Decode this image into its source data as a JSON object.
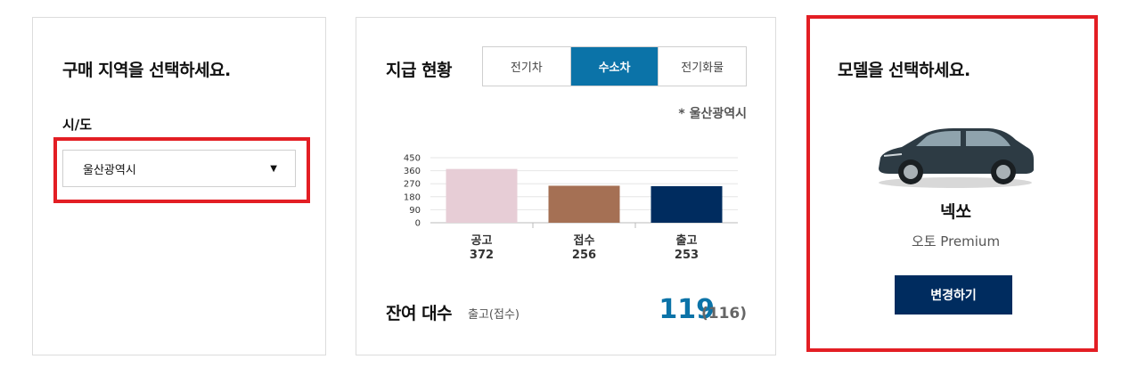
{
  "region_card": {
    "title": "구매 지역을 선택하세요.",
    "sido_label": "시/도",
    "select_value": "울산광역시",
    "select_arrow": "▼"
  },
  "status_card": {
    "title": "지급 현황",
    "tabs": [
      {
        "label": "전기차",
        "active": false
      },
      {
        "label": "수소차",
        "active": true
      },
      {
        "label": "전기화물",
        "active": false
      }
    ],
    "region_note": "* 울산광역시",
    "remaining_label": "잔여 대수",
    "remaining_sub": "출고(접수)",
    "remaining_value": "119",
    "remaining_paren": "(116)"
  },
  "chart_data": {
    "type": "bar",
    "categories": [
      "공고",
      "접수",
      "출고"
    ],
    "values": [
      372,
      256,
      253
    ],
    "value_labels": [
      "372",
      "256",
      "253"
    ],
    "colors": [
      "#e7cdd6",
      "#a57054",
      "#002c5f"
    ],
    "yticks": [
      "450",
      "360",
      "270",
      "180",
      "90",
      "0"
    ],
    "ylim": [
      0,
      450
    ],
    "grid": true
  },
  "model_card": {
    "title": "모델을 선택하세요.",
    "car_icon": "suv-car-image",
    "model_name": "넥쏘",
    "model_trim": "오토 Premium",
    "change_label": "변경하기"
  },
  "colors": {
    "accent_blue": "#0b73a8",
    "navy": "#002c5f",
    "highlight_red": "#e31e24"
  }
}
